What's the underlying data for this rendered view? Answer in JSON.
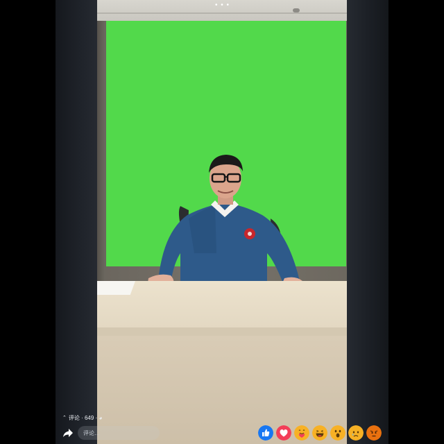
{
  "video": {
    "overflow_menu_icon": "more-dots-icon",
    "overflow_menu_glyph": "• • •"
  },
  "comments": {
    "summary_label": "评论 · 649 · ◕",
    "toggle_icon": "chevron-up-icon",
    "toggle_glyph": "⌃"
  },
  "comment_input": {
    "placeholder": "评论…",
    "value": ""
  },
  "share": {
    "icon": "share-arrow-icon"
  },
  "reactions": [
    {
      "name": "like",
      "icon": "thumbs-up-icon",
      "color": "#1877f2"
    },
    {
      "name": "love",
      "icon": "heart-icon",
      "color": "#f33e58"
    },
    {
      "name": "care",
      "icon": "care-hug-icon",
      "color": "#f7b125"
    },
    {
      "name": "haha",
      "icon": "laughing-face-icon",
      "color": "#f7b125"
    },
    {
      "name": "wow",
      "icon": "surprised-face-icon",
      "color": "#f7b125"
    },
    {
      "name": "sad",
      "icon": "sad-face-icon",
      "color": "#f7b125"
    },
    {
      "name": "angry",
      "icon": "angry-face-icon",
      "color": "#e9710f"
    }
  ]
}
